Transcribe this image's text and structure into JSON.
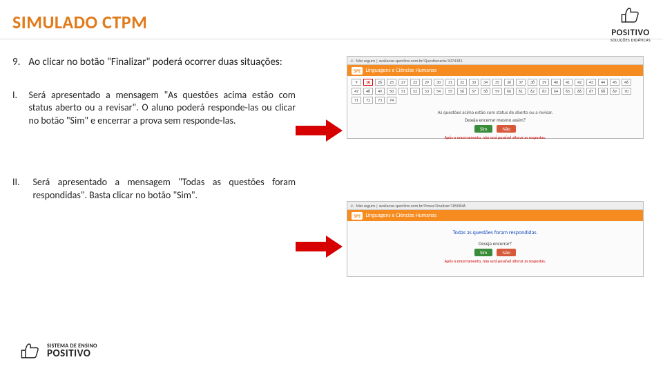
{
  "header": {
    "title": "SIMULADO CTPM"
  },
  "logo_top": {
    "brand": "POSITIVO",
    "sub": "SOLUÇÕES DIDÁTICAS"
  },
  "step9": {
    "num": "9.",
    "text": "Ao clicar no botão \"Finalizar\" poderá ocorrer duas situações:"
  },
  "items": [
    {
      "rn": "I.",
      "text": "Será apresentado a mensagem \"As questões acima estão com status aberto ou a revisar\". O aluno poderá responde-las ou clicar no botão \"Sim\" e encerrar a prova sem responde-las."
    },
    {
      "rn": "II.",
      "text": "Será apresentado a mensagem \"Todas as questões foram respondidas\". Basta clicar no botão \"Sim\"."
    }
  ],
  "shot1": {
    "url_hint": "Não seguro | avaliacao.sponline.com.br/Questionario/1074181",
    "bar_label": "Linguagens e Ciências Humanas",
    "spe": "SPE",
    "numbers": [
      "9",
      "10",
      "26",
      "25",
      "27",
      "23",
      "29",
      "30",
      "31",
      "32",
      "33",
      "34",
      "35",
      "36",
      "37",
      "38",
      "39",
      "40",
      "41",
      "42",
      "43",
      "44",
      "45",
      "46",
      "47",
      "48",
      "49",
      "50",
      "51",
      "52",
      "53",
      "54",
      "55",
      "56",
      "57",
      "58",
      "59",
      "60",
      "61",
      "62",
      "63",
      "64",
      "65",
      "66",
      "67",
      "68",
      "69",
      "70",
      "71",
      "72",
      "73",
      "74"
    ],
    "msg": "As questões acima estão com status de aberto ou a revisar.",
    "encerra": "Deseja encerrar mesmo assim?",
    "sim": "Sim",
    "nao": "Não",
    "warn": "Após o encerramento, não será possível alterar as respostas."
  },
  "shot2": {
    "url_hint": "Não seguro | avaliacao.sponline.com.br/Prova/Finalizar/1850846",
    "bar_label": "Linguagens e Ciências Humanas",
    "spe": "SPE",
    "all_done": "Todas as questões foram respondidas.",
    "encerra": "Deseja encerrar?",
    "sim": "Sim",
    "nao": "Não",
    "warn": "Após o encerramento, não será possível alterar as respostas."
  },
  "footer": {
    "l1": "SISTEMA DE ENSINO",
    "l2": "POSITIVO"
  }
}
